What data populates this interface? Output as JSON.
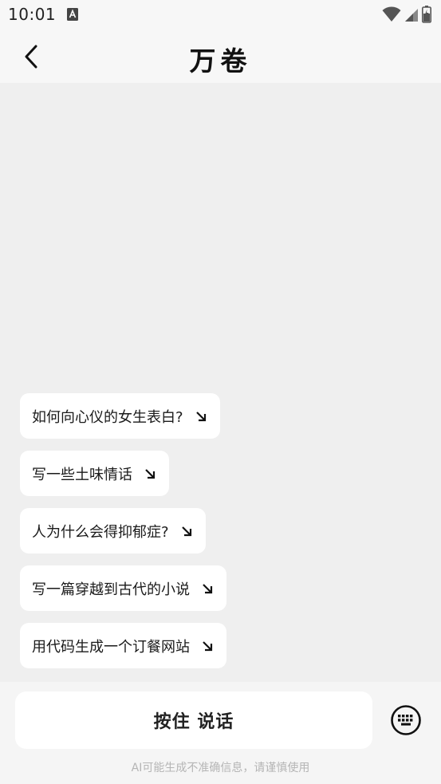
{
  "status_bar": {
    "time": "10:01",
    "icons": [
      "a-notification-icon",
      "wifi-icon",
      "signal-icon",
      "battery-icon"
    ]
  },
  "header": {
    "title": "万卷",
    "back_icon": "chevron-left-icon"
  },
  "suggestions": [
    {
      "label": "如何向心仪的女生表白?",
      "icon": "arrow-down-right-icon"
    },
    {
      "label": "写一些土味情话",
      "icon": "arrow-down-right-icon"
    },
    {
      "label": "人为什么会得抑郁症?",
      "icon": "arrow-down-right-icon"
    },
    {
      "label": "写一篇穿越到古代的小说",
      "icon": "arrow-down-right-icon"
    },
    {
      "label": "用代码生成一个订餐网站",
      "icon": "arrow-down-right-icon"
    }
  ],
  "input": {
    "hold_to_talk_label": "按住 说话",
    "keyboard_icon": "keyboard-icon"
  },
  "disclaimer": "AI可能生成不准确信息，请谨慎使用"
}
